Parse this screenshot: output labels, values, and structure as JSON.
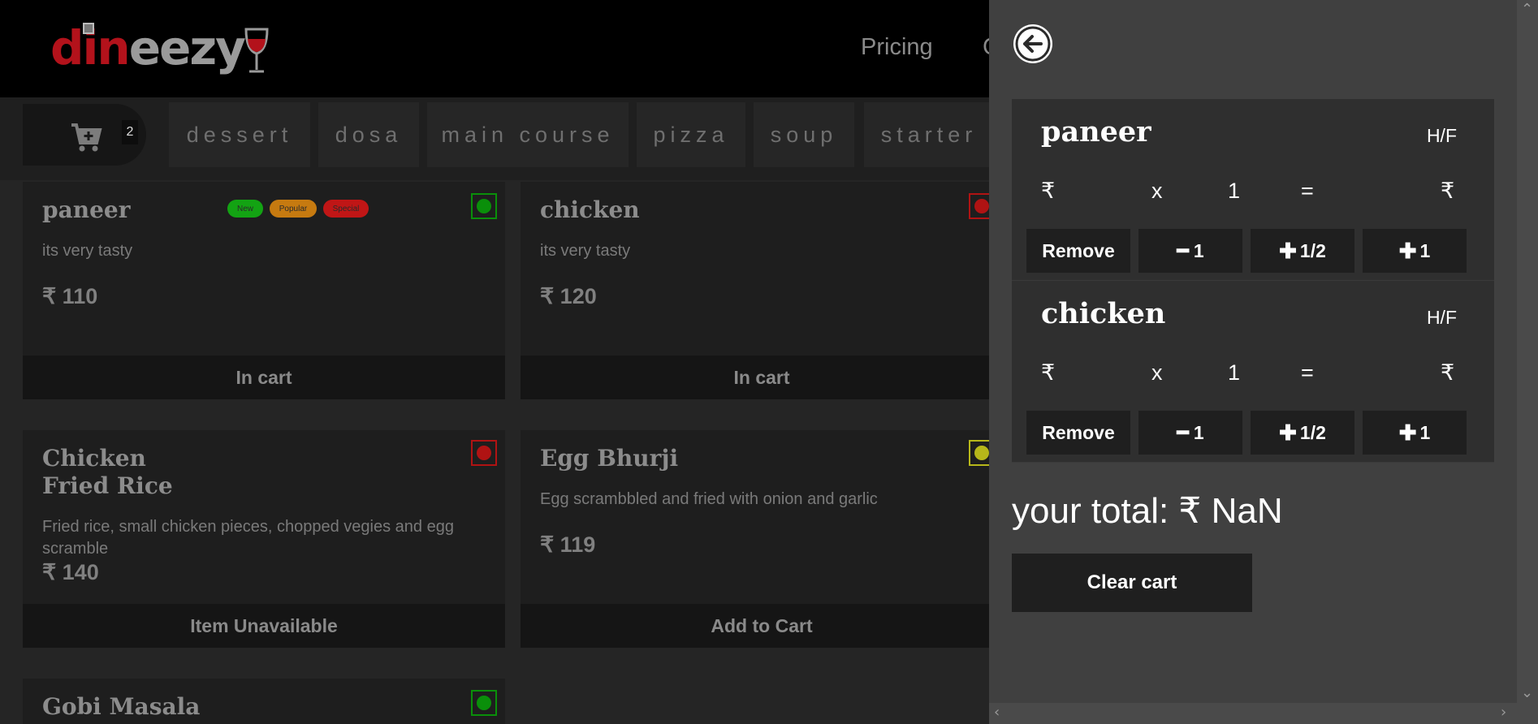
{
  "header": {
    "logo_a": "di",
    "logo_b": "n",
    "logo_c": "eez",
    "logo_d": "y",
    "nav": [
      "Pricing",
      "C"
    ]
  },
  "cart_button": {
    "count": "2"
  },
  "categories": [
    "dessert",
    "dosa",
    "main course",
    "pizza",
    "soup",
    "starter"
  ],
  "menu": [
    {
      "name": "paneer",
      "desc": "its very tasty",
      "price": "₹ 110",
      "action": "In cart",
      "type": "veg",
      "badges": [
        "New",
        "Popular",
        "Special"
      ]
    },
    {
      "name": "chicken",
      "desc": "its very tasty",
      "price": "₹ 120",
      "action": "In cart",
      "type": "nonveg"
    },
    {
      "name_line1": "Chicken",
      "name_line2": "Fried Rice",
      "desc": "Fried rice, small chicken pieces, chopped vegies and egg scramble",
      "price": "₹ 140",
      "action": "Item Unavailable",
      "type": "nonveg"
    },
    {
      "name": "Egg Bhurji",
      "desc": "Egg scrambbled and fried with onion and garlic",
      "price": "₹ 119",
      "action": "Add to Cart",
      "type": "egg"
    },
    {
      "name": "Gobi Masala",
      "type": "veg"
    }
  ],
  "colors": {
    "veg": "#0a8f0a",
    "nonveg": "#b01313",
    "egg": "#b7b71a",
    "badge_new": "#13a313",
    "badge_popular": "#c67a10",
    "badge_special": "#c01616"
  },
  "cart": {
    "items": [
      {
        "name": "paneer",
        "hf": "H/F",
        "rupee": "₹",
        "x": "x",
        "qty": "1",
        "eq": "=",
        "total": "₹",
        "remove": "Remove",
        "minus": "1",
        "half": "1/2",
        "plus": "1"
      },
      {
        "name": "chicken",
        "hf": "H/F",
        "rupee": "₹",
        "x": "x",
        "qty": "1",
        "eq": "=",
        "total": "₹",
        "remove": "Remove",
        "minus": "1",
        "half": "1/2",
        "plus": "1"
      }
    ],
    "total_label": "your total: ₹ NaN",
    "clear_label": "Clear cart"
  }
}
